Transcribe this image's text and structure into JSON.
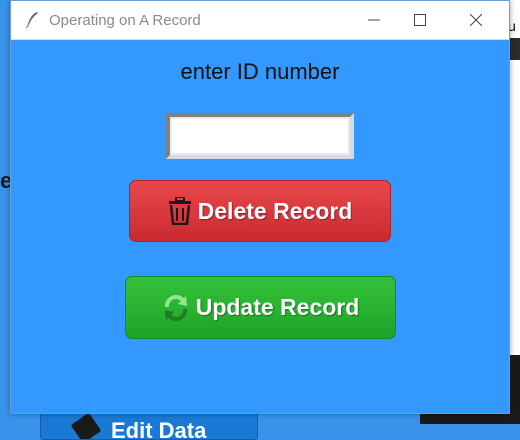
{
  "window": {
    "title": "Operating on A Record"
  },
  "form": {
    "prompt": "enter ID number",
    "id_value": "",
    "delete_label": "Delete Record",
    "update_label": "Update Record"
  },
  "background": {
    "edit_label": "Edit Data",
    "left_letter": "e",
    "right_letter": "u"
  },
  "icons": {
    "title": "feather-icon",
    "delete": "trash-icon",
    "update": "refresh-icon",
    "edit": "pencil-icon"
  },
  "colors": {
    "window_bg": "#3399ff",
    "delete_bg": "#d63a3f",
    "update_bg": "#2bb531"
  }
}
